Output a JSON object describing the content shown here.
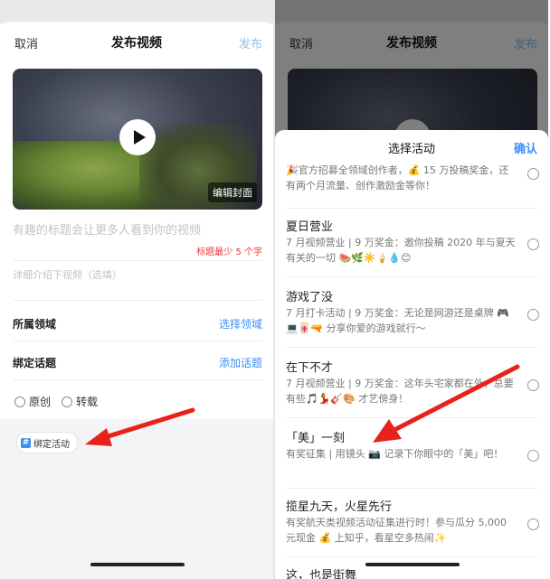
{
  "left": {
    "header": {
      "cancel": "取消",
      "title": "发布视频",
      "publish": "发布"
    },
    "video": {
      "edit_cover": "编辑封面"
    },
    "title_placeholder": "有趣的标题会让更多人看到你的视频",
    "title_hint": "标题最少 5 个字",
    "desc_placeholder": "详细介绍下视频（选填）",
    "domain_row": {
      "label": "所属领域",
      "action": "选择领域"
    },
    "topic_row": {
      "label": "绑定话题",
      "action": "添加话题"
    },
    "radios": [
      {
        "label": "原创"
      },
      {
        "label": "转载"
      }
    ],
    "bind_activity": "绑定活动"
  },
  "right": {
    "header": {
      "cancel": "取消",
      "title": "发布视频",
      "publish": "发布"
    },
    "sheet": {
      "title": "选择活动",
      "confirm": "确认",
      "activities": [
        {
          "name": "",
          "desc": "🎉官方招募全领域创作者，💰 15 万投稿奖金，还有两个月流量、创作激励金等你！"
        },
        {
          "name": "夏日营业",
          "desc": "7 月视频营业 | 9 万奖金：邀你投稿 2020 年与夏天有关的一切 🍉🌿☀️🍦💧😊"
        },
        {
          "name": "游戏了没",
          "desc": "7 月打卡活动 | 9 万奖金：无论是网游还是桌牌 🎮💻🀄🔫 分享你爱的游戏就行～"
        },
        {
          "name": "在下不才",
          "desc": "7 月视频营业 | 9 万奖金：这年头宅家都在外，总要有些🎵💃🎸🎨 才艺傍身！"
        },
        {
          "name": "「美」一刻",
          "desc": "有奖征集 | 用镜头 📷 记录下你眼中的「美」吧！"
        },
        {
          "name": "揽星九天，火星先行",
          "desc": "有奖航天类视频活动征集进行时！参与瓜分 5,000 元现金 💰 上知乎，看星空多热闹✨"
        },
        {
          "name": "这，也是街舞",
          "desc": ""
        }
      ]
    }
  },
  "colors": {
    "accent": "#3d8ef2",
    "warning": "#e4393c",
    "arrow": "#e8221b"
  }
}
